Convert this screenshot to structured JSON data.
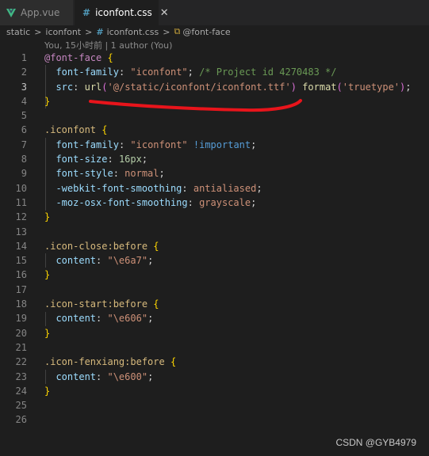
{
  "tabs": [
    {
      "label": "App.vue",
      "icon": "vue-icon",
      "active": false
    },
    {
      "label": "iconfont.css",
      "icon": "css-hash-icon",
      "active": true,
      "close": "✕"
    }
  ],
  "breadcrumb": {
    "items": [
      "static",
      "iconfont",
      "iconfont.css",
      "@font-face"
    ],
    "separator": ">"
  },
  "blame": "You, 15小时前 | 1 author (You)",
  "line_numbers": [
    "1",
    "2",
    "3",
    "4",
    "5",
    "6",
    "7",
    "8",
    "9",
    "10",
    "11",
    "12",
    "13",
    "14",
    "15",
    "16",
    "17",
    "18",
    "19",
    "20",
    "21",
    "22",
    "23",
    "24",
    "25",
    "26"
  ],
  "code": {
    "l1_at": "@font-face",
    "l1_brace": "{",
    "l2_prop": "font-family",
    "l2_val": "\"iconfont\"",
    "l2_comment": "/* Project id 4270483 */",
    "l3_prop": "src",
    "l3_url": "url",
    "l3_url_arg": "'@/static/iconfont/iconfont.ttf'",
    "l3_format": "format",
    "l3_format_arg": "'truetype'",
    "l4_brace": "}",
    "l6_sel": ".iconfont",
    "l7_prop": "font-family",
    "l7_val": "\"iconfont\"",
    "l7_imp": "!important",
    "l8_prop": "font-size",
    "l8_val": "16px",
    "l9_prop": "font-style",
    "l9_val": "normal",
    "l10_prop": "-webkit-font-smoothing",
    "l10_val": "antialiased",
    "l11_prop": "-moz-osx-font-smoothing",
    "l11_val": "grayscale",
    "l14_sel": ".icon-close:before",
    "l15_prop": "content",
    "l15_val": "\"\\e6a7\"",
    "l18_sel": ".icon-start:before",
    "l19_prop": "content",
    "l19_val": "\"\\e606\"",
    "l22_sel": ".icon-fenxiang:before",
    "l23_prop": "content",
    "l23_val": "\"\\e600\""
  },
  "watermark": "CSDN @GYB4979",
  "colors": {
    "background": "#1e1e1e",
    "annotation_underline": "#e8141b"
  }
}
